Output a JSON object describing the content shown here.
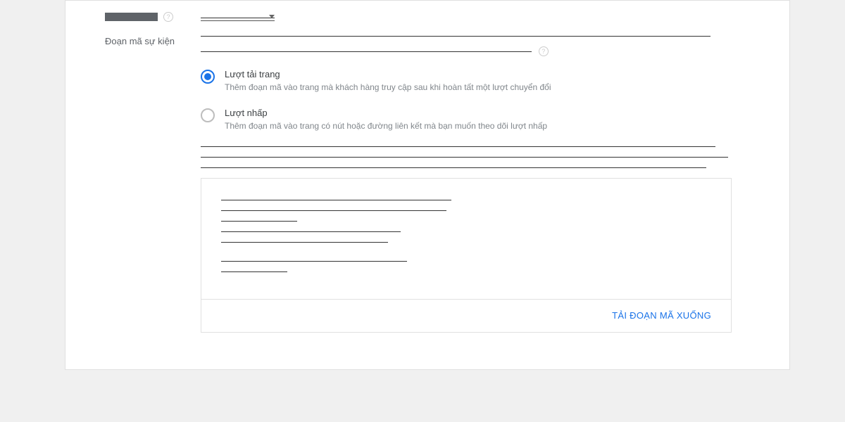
{
  "form": {
    "redacted_field_label": "",
    "event_code_label": "Đoạn mã sự kiện",
    "radio_options": [
      {
        "id": "page-load",
        "title": "Lượt tải trang",
        "desc": "Thêm đoạn mã vào trang mà khách hàng truy cập sau khi hoàn tất một lượt chuyển đổi",
        "selected": true
      },
      {
        "id": "click",
        "title": "Lượt nhấp",
        "desc": "Thêm đoạn mã vào trang có nút hoặc đường liên kết mà bạn muốn theo dõi lượt nhấp",
        "selected": false
      }
    ]
  },
  "code_box": {
    "download_label": "TẢI ĐOẠN MÃ XUỐNG"
  }
}
